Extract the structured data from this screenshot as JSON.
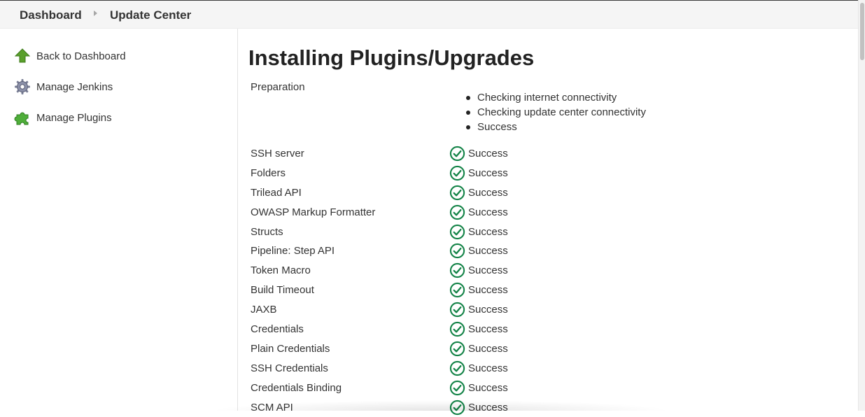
{
  "breadcrumb": {
    "items": [
      "Dashboard",
      "Update Center"
    ]
  },
  "sidebar": {
    "items": [
      {
        "label": "Back to Dashboard",
        "icon": "up-arrow-icon"
      },
      {
        "label": "Manage Jenkins",
        "icon": "gear-icon"
      },
      {
        "label": "Manage Plugins",
        "icon": "puzzle-piece-icon"
      }
    ]
  },
  "main": {
    "title": "Installing Plugins/Upgrades",
    "preparation": {
      "label": "Preparation",
      "steps": [
        "Checking internet connectivity",
        "Checking update center connectivity",
        "Success"
      ]
    },
    "plugins": [
      {
        "name": "SSH server",
        "status": "Success"
      },
      {
        "name": "Folders",
        "status": "Success"
      },
      {
        "name": "Trilead API",
        "status": "Success"
      },
      {
        "name": "OWASP Markup Formatter",
        "status": "Success"
      },
      {
        "name": "Structs",
        "status": "Success"
      },
      {
        "name": "Pipeline: Step API",
        "status": "Success"
      },
      {
        "name": "Token Macro",
        "status": "Success"
      },
      {
        "name": "Build Timeout",
        "status": "Success"
      },
      {
        "name": "JAXB",
        "status": "Success"
      },
      {
        "name": "Credentials",
        "status": "Success"
      },
      {
        "name": "Plain Credentials",
        "status": "Success"
      },
      {
        "name": "SSH Credentials",
        "status": "Success"
      },
      {
        "name": "Credentials Binding",
        "status": "Success"
      },
      {
        "name": "SCM API",
        "status": "Success"
      }
    ]
  },
  "colors": {
    "success": "#138347",
    "accent_green": "#4caf50",
    "breadcrumb_bg": "#f5f5f5"
  }
}
